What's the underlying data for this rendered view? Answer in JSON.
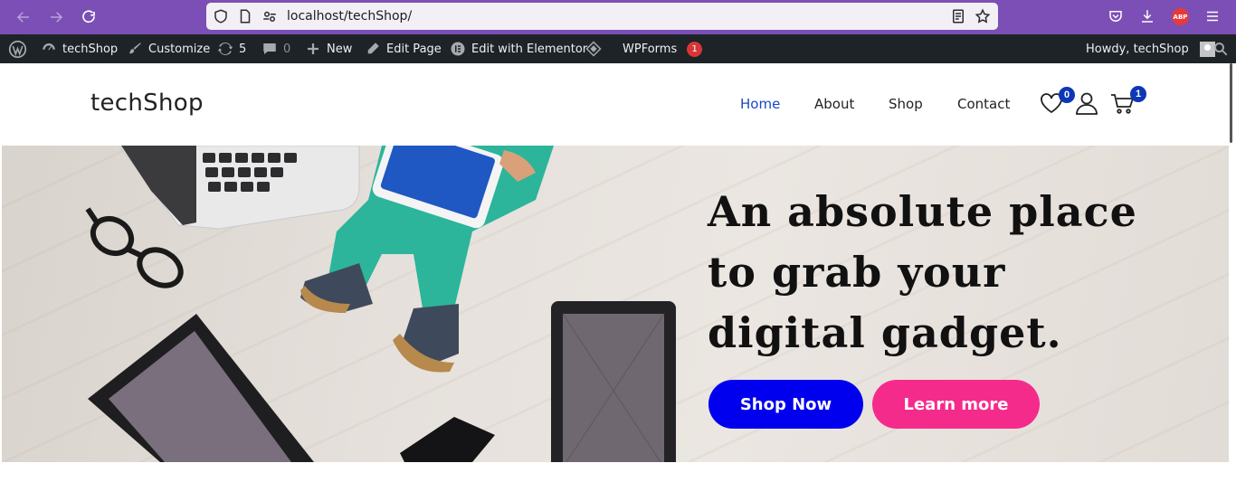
{
  "browser": {
    "url": "localhost/techShop/",
    "abp_label": "ABP"
  },
  "admin_bar": {
    "site_name": "techShop",
    "customize": "Customize",
    "updates_count": "5",
    "comments_count": "0",
    "new": "New",
    "edit_page": "Edit Page",
    "edit_elementor": "Edit with Elementor",
    "wpforms": "WPForms",
    "wpforms_badge": "1",
    "howdy": "Howdy, techShop"
  },
  "header": {
    "logo": "techShop",
    "menu": [
      {
        "label": "Home"
      },
      {
        "label": "About"
      },
      {
        "label": "Shop"
      },
      {
        "label": "Contact"
      }
    ],
    "wishlist_count": "0",
    "cart_count": "1"
  },
  "hero": {
    "title": "An absolute place to grab your digital gadget.",
    "shop_button": "Shop Now",
    "learn_button": "Learn more"
  },
  "colors": {
    "browser_bar": "#7b4fb5",
    "admin_bar": "#1d2327",
    "active_menu": "#1a47c9",
    "shop_button": "#0000ee",
    "learn_button": "#f52b8c",
    "badge": "#0c37b5"
  }
}
